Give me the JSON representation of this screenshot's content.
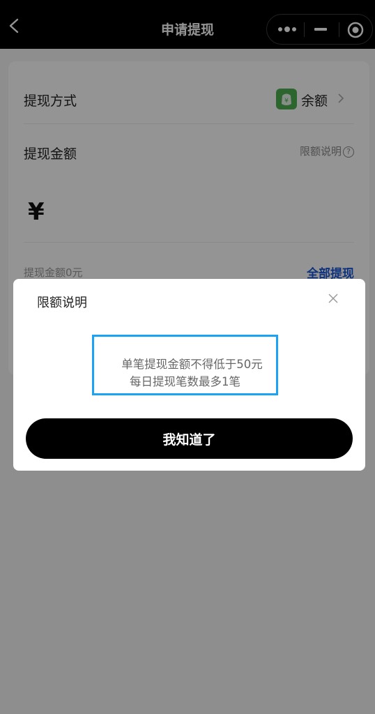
{
  "navbar": {
    "title": "申请提现",
    "back_icon": "chevron-left-icon",
    "capsule_icons": [
      "more-dots-icon",
      "minimize-icon",
      "target-close-icon"
    ]
  },
  "form": {
    "method_label": "提现方式",
    "method_value": "余额",
    "method_icon": "wallet-icon",
    "amount_label": "提现金额",
    "limit_link": "限额说明",
    "help_icon_glyph": "?",
    "currency_symbol": "¥",
    "available_text": "提现金额0元",
    "withdraw_all": "全部提现",
    "accent_color": "#1a57d6"
  },
  "dialog": {
    "title": "限额说明",
    "rules": [
      "单笔提现金额不得低于50元",
      "每日提现笔数最多1笔"
    ],
    "confirm_label": "我知道了",
    "highlight_color": "#1aa3f5"
  }
}
